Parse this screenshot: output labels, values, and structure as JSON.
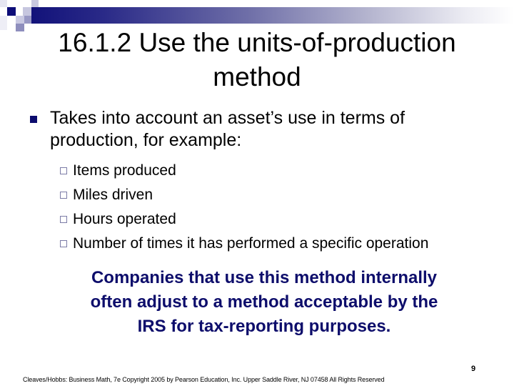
{
  "slide": {
    "title_lines": [
      "16.1.2   Use the units-of-production",
      "method"
    ],
    "bullet": {
      "icon": "filled-square-bullet",
      "text": "Takes into account an asset’s use in terms of production, for example:"
    },
    "sub_bullets": [
      {
        "icon": "hollow-square-bullet",
        "text": "Items produced"
      },
      {
        "icon": "hollow-square-bullet",
        "text": "Miles driven"
      },
      {
        "icon": "hollow-square-bullet",
        "text": "Hours operated"
      },
      {
        "icon": "hollow-square-bullet",
        "text": "Number of times it has performed a specific operation"
      }
    ],
    "callout_lines": [
      "Companies that use this method internally",
      "often adjust to a method acceptable by the",
      "IRS for tax-reporting purposes."
    ],
    "page_number": "9",
    "footer": "Cleaves/Hobbs: Business Math, 7e  Copyright 2005 by Pearson Education, Inc. Upper Saddle River, NJ 07458  All Rights Reserved"
  },
  "colors": {
    "accent_dark": "#12127a",
    "callout_text": "#0d0d6b",
    "sub_bullet_border": "#7b7ba6"
  }
}
